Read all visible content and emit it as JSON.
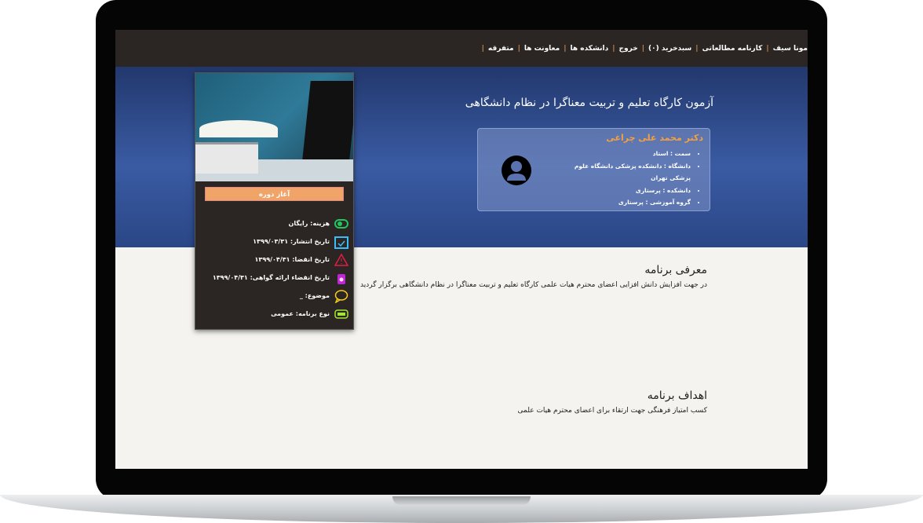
{
  "nav": {
    "items": [
      "مونا سیف",
      "کارنامه مطالعاتی",
      "سبدخرید (۰)",
      "خروج",
      "دانشکده ها",
      "معاونت ها",
      "متفرقه"
    ]
  },
  "course": {
    "title": "آزمون کارگاه تعلیم و تربیت معناگرا در نظام دانشگاهی",
    "start_label": "آغاز دوره"
  },
  "teacher": {
    "name": "دکتر محمد علی چراغی",
    "details": [
      "سمت : استاد",
      "دانشگاه : دانشکده پزشکی دانشگاه علوم پزشکی تهران",
      "دانشکده : پرستاری",
      "گروه آموزشی : پرستاری"
    ]
  },
  "info": [
    {
      "icon": "money-icon",
      "color": "#22c55e",
      "text": "هزینه: رایگان"
    },
    {
      "icon": "calendar-check-icon",
      "color": "#38bdf8",
      "text": "تاریخ انتشار: ۱۳۹۹/۰۳/۳۱"
    },
    {
      "icon": "warning-icon",
      "color": "#e11d48",
      "text": "تاریخ انقضا: ۱۳۹۹/۰۴/۳۱"
    },
    {
      "icon": "certificate-icon",
      "color": "#c026d3",
      "text": "تاریخ انقضاء ارائه گواهی: ۱۳۹۹/۰۴/۳۱"
    },
    {
      "icon": "chat-bubble-icon",
      "color": "#facc15",
      "text": "موضوع: _"
    },
    {
      "icon": "program-type-icon",
      "color": "#a3e635",
      "text": "نوع برنامه: عمومی"
    }
  ],
  "intro": {
    "heading": "معرفی برنامه",
    "text": "در جهت افزایش دانش افزایی اعضای محترم هیات علمی کارگاه تعلیم و تربیت معناگرا در نظام دانشگاهی  برگزار گردید"
  },
  "goals": {
    "heading": "اهداف برنامه",
    "text": "کسب امتیاز فرهنگی  جهت ارتقاء برای  اعضای محترم هیات علمی"
  }
}
